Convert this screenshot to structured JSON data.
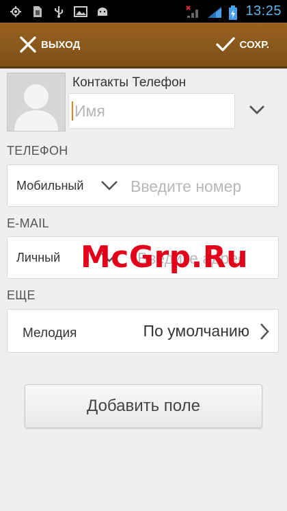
{
  "status_bar": {
    "time": "13:25",
    "icons": [
      "gps-icon",
      "sim-icon",
      "usb-icon",
      "gallery-icon",
      "android-icon",
      "signal-icon",
      "data-signal-icon",
      "battery-icon"
    ]
  },
  "action_bar": {
    "exit_label": "ВЫХОД",
    "save_label": "СОХР."
  },
  "contact": {
    "account_label": "Контакты Телефон",
    "name_placeholder": "Имя"
  },
  "phone": {
    "section_title": "ТЕЛЕФОН",
    "type_label": "Мобильный",
    "placeholder": "Введите номер"
  },
  "email": {
    "section_title": "E-MAIL",
    "type_label": "Личный",
    "placeholder": "Введите адрес"
  },
  "more": {
    "section_title": "ЕЩЕ",
    "ringtone_label": "Мелодия",
    "ringtone_value": "По умолчанию"
  },
  "add_field_label": "Добавить поле",
  "watermark": "McGrp.Ru",
  "colors": {
    "action_bar": "#8a5a1c",
    "accent_cursor": "#e2851c",
    "clock": "#5fb5e8",
    "watermark": "#e3001a"
  }
}
